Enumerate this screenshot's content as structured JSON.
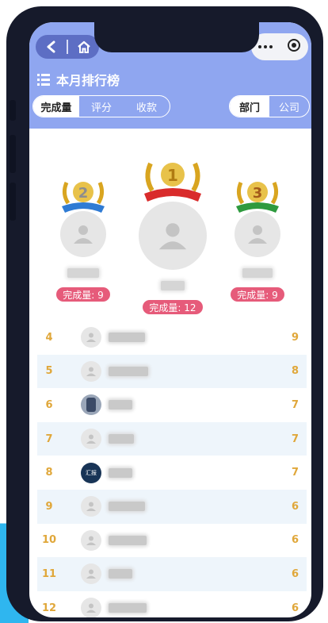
{
  "header": {
    "title": "本月排行榜",
    "title_icon": "list-icon",
    "nav_icons": [
      "back-icon",
      "home-icon"
    ],
    "capsule_icons": [
      "more-dots-icon",
      "close-target-icon"
    ],
    "tabs_left": [
      {
        "label": "完成量",
        "active": true
      },
      {
        "label": "评分",
        "active": false
      },
      {
        "label": "收款",
        "active": false
      }
    ],
    "tabs_right": [
      {
        "label": "部门",
        "active": true
      },
      {
        "label": "公司",
        "active": false
      }
    ],
    "background_color": "#8fa6f0"
  },
  "podium": [
    {
      "rank": "2",
      "badge": "完成量: 9",
      "ribbon_color": "#2f7bd4",
      "avatar_icon": "user-placeholder-icon"
    },
    {
      "rank": "1",
      "badge": "完成量: 12",
      "ribbon_color": "#d92b2b",
      "avatar_icon": "user-placeholder-icon"
    },
    {
      "rank": "3",
      "badge": "完成量: 9",
      "ribbon_color": "#2e9a3e",
      "avatar_icon": "user-placeholder-icon"
    }
  ],
  "list": [
    {
      "rank": "4",
      "score": "9",
      "avatar": "user-placeholder-icon"
    },
    {
      "rank": "5",
      "score": "8",
      "avatar": "user-placeholder-icon"
    },
    {
      "rank": "6",
      "score": "7",
      "avatar": "photo-avatar"
    },
    {
      "rank": "7",
      "score": "7",
      "avatar": "user-placeholder-icon"
    },
    {
      "rank": "8",
      "score": "7",
      "avatar": "logo-avatar",
      "avatar_text": "汇报"
    },
    {
      "rank": "9",
      "score": "6",
      "avatar": "user-placeholder-icon"
    },
    {
      "rank": "10",
      "score": "6",
      "avatar": "user-placeholder-icon"
    },
    {
      "rank": "11",
      "score": "6",
      "avatar": "user-placeholder-icon"
    },
    {
      "rank": "12",
      "score": "6",
      "avatar": "user-placeholder-icon"
    }
  ],
  "colors": {
    "accent": "#8fa6f0",
    "badge": "#e65b7a",
    "rank_gold": "#e0a73a",
    "row_alt": "#eef5fb"
  }
}
